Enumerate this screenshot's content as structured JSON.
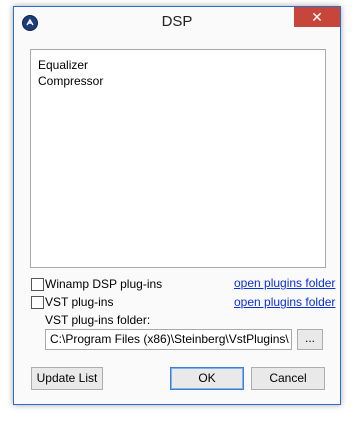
{
  "window": {
    "title": "DSP",
    "close_glyph": "✕"
  },
  "icons": {
    "app": "winamp-logo-icon",
    "close": "close-icon"
  },
  "list": {
    "items": [
      "Equalizer",
      "Compressor"
    ]
  },
  "options": {
    "winamp_label": "Winamp DSP plug-ins",
    "winamp_checked": false,
    "winamp_link": "open plugins folder",
    "vst_label": "VST plug-ins",
    "vst_checked": false,
    "vst_link": "open plugins folder",
    "vst_folder_label": "VST plug-ins folder:",
    "vst_folder_value": "C:\\Program Files (x86)\\Steinberg\\VstPlugins\\",
    "browse_label": "..."
  },
  "buttons": {
    "update_list": "Update List",
    "ok": "OK",
    "cancel": "Cancel"
  },
  "colors": {
    "close_button": "#c7463b",
    "window_border": "#2b6cd1",
    "link": "#0a2fd6"
  }
}
